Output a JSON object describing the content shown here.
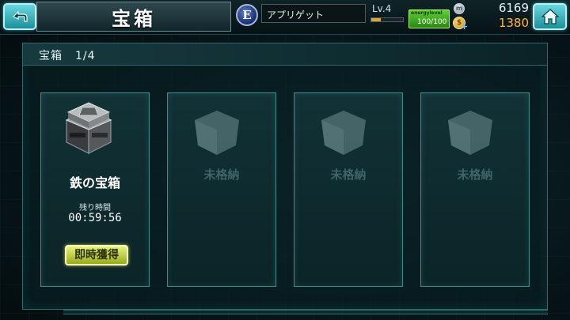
{
  "header": {
    "title": "宝箱",
    "rank_letter": "E",
    "player_name": "アプリゲット",
    "level_label": "Lv.4",
    "level_progress": 0.3,
    "energy_label": "energylevel",
    "energy_value": "100/100",
    "coin_symbol": "m",
    "coins": "6169",
    "gems": "1380",
    "gem_symbol": "$",
    "plus": "+"
  },
  "panel": {
    "title": "宝箱",
    "count": "1/4"
  },
  "slots": [
    {
      "state": "filled",
      "name": "鉄の宝箱",
      "remaining_label": "残り時間",
      "timer": "00:59:56",
      "button_label": "即時獲得"
    },
    {
      "state": "empty",
      "label": "未格納"
    },
    {
      "state": "empty",
      "label": "未格納"
    },
    {
      "state": "empty",
      "label": "未格納"
    }
  ],
  "colors": {
    "accent": "#3d8a8f",
    "button": "#c9d63a",
    "gold": "#ffb63b",
    "energy": "#4fb52a"
  }
}
